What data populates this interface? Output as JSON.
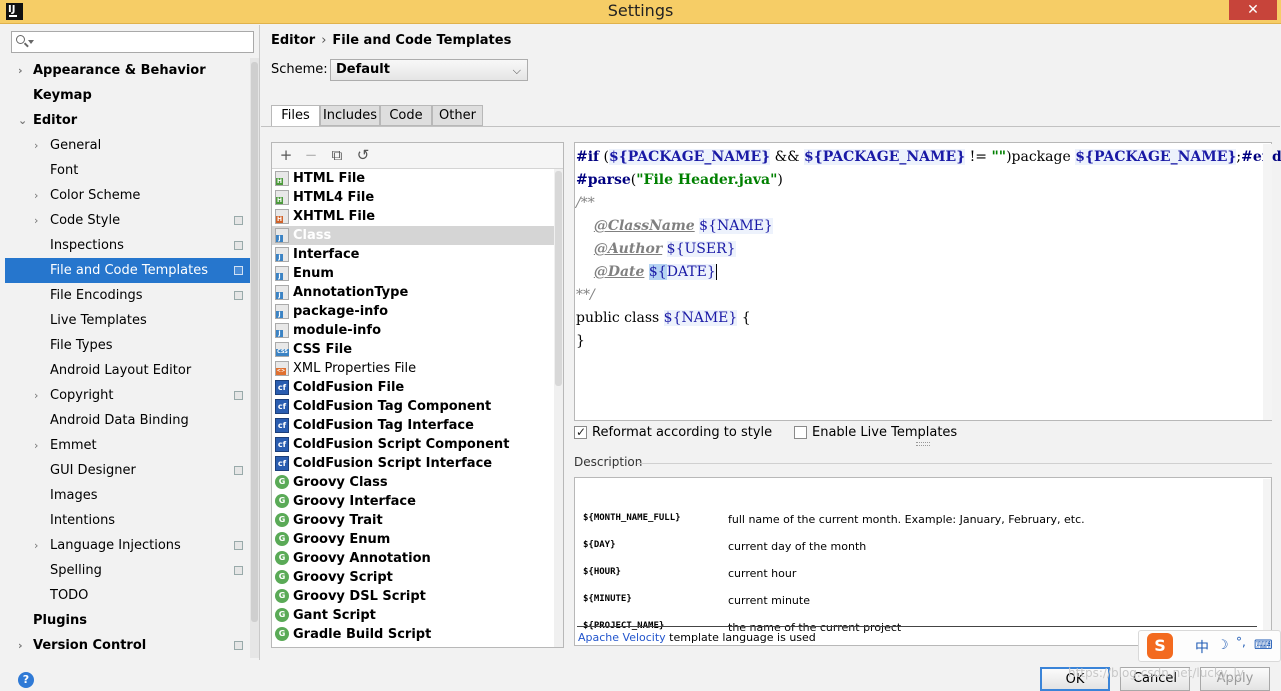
{
  "window": {
    "title": "Settings",
    "app_icon_text": "IJ",
    "close_glyph": "✕"
  },
  "search": {
    "placeholder": "",
    "value": ""
  },
  "sidebar": {
    "items": [
      {
        "label": "Appearance & Behavior",
        "level": 0,
        "bold": true,
        "arrow": "›"
      },
      {
        "label": "Keymap",
        "level": 0,
        "bold": true,
        "arrow": ""
      },
      {
        "label": "Editor",
        "level": 0,
        "bold": true,
        "arrow": "⌄"
      },
      {
        "label": "General",
        "level": 1,
        "arrow": "›"
      },
      {
        "label": "Font",
        "level": 1,
        "arrow": ""
      },
      {
        "label": "Color Scheme",
        "level": 1,
        "arrow": "›"
      },
      {
        "label": "Code Style",
        "level": 1,
        "arrow": "›",
        "project": true
      },
      {
        "label": "Inspections",
        "level": 1,
        "arrow": "",
        "project": true
      },
      {
        "label": "File and Code Templates",
        "level": 1,
        "arrow": "",
        "project": true,
        "selected": true
      },
      {
        "label": "File Encodings",
        "level": 1,
        "arrow": "",
        "project": true
      },
      {
        "label": "Live Templates",
        "level": 1,
        "arrow": ""
      },
      {
        "label": "File Types",
        "level": 1,
        "arrow": ""
      },
      {
        "label": "Android Layout Editor",
        "level": 1,
        "arrow": ""
      },
      {
        "label": "Copyright",
        "level": 1,
        "arrow": "›",
        "project": true
      },
      {
        "label": "Android Data Binding",
        "level": 1,
        "arrow": ""
      },
      {
        "label": "Emmet",
        "level": 1,
        "arrow": "›"
      },
      {
        "label": "GUI Designer",
        "level": 1,
        "arrow": "",
        "project": true
      },
      {
        "label": "Images",
        "level": 1,
        "arrow": ""
      },
      {
        "label": "Intentions",
        "level": 1,
        "arrow": ""
      },
      {
        "label": "Language Injections",
        "level": 1,
        "arrow": "›",
        "project": true
      },
      {
        "label": "Spelling",
        "level": 1,
        "arrow": "",
        "project": true
      },
      {
        "label": "TODO",
        "level": 1,
        "arrow": ""
      },
      {
        "label": "Plugins",
        "level": 0,
        "bold": true,
        "arrow": ""
      },
      {
        "label": "Version Control",
        "level": 0,
        "bold": true,
        "arrow": "›",
        "project": true
      }
    ]
  },
  "breadcrumb": {
    "parent": "Editor",
    "separator": "›",
    "current": "File and Code Templates"
  },
  "scheme": {
    "label": "Scheme:",
    "value": "Default",
    "chevron": "⌵"
  },
  "tabs": [
    {
      "label": "Files",
      "active": true
    },
    {
      "label": "Includes"
    },
    {
      "label": "Code"
    },
    {
      "label": "Other"
    }
  ],
  "toolbar": {
    "add": "+",
    "remove": "−",
    "copy": "⧉",
    "reset": "↺"
  },
  "templates": [
    {
      "label": "HTML File",
      "icon": "html",
      "bold": true
    },
    {
      "label": "HTML4 File",
      "icon": "html",
      "bold": true
    },
    {
      "label": "XHTML File",
      "icon": "xhtml",
      "bold": true
    },
    {
      "label": "Class",
      "icon": "java",
      "bold": true,
      "selected": true
    },
    {
      "label": "Interface",
      "icon": "java",
      "bold": true
    },
    {
      "label": "Enum",
      "icon": "java",
      "bold": true
    },
    {
      "label": "AnnotationType",
      "icon": "java",
      "bold": true
    },
    {
      "label": "package-info",
      "icon": "java",
      "bold": true
    },
    {
      "label": "module-info",
      "icon": "java",
      "bold": true
    },
    {
      "label": "CSS File",
      "icon": "css",
      "bold": true
    },
    {
      "label": "XML Properties File",
      "icon": "xml",
      "bold": false
    },
    {
      "label": "ColdFusion File",
      "icon": "cf",
      "bold": true
    },
    {
      "label": "ColdFusion Tag Component",
      "icon": "cf",
      "bold": true
    },
    {
      "label": "ColdFusion Tag Interface",
      "icon": "cf",
      "bold": true
    },
    {
      "label": "ColdFusion Script Component",
      "icon": "cf",
      "bold": true
    },
    {
      "label": "ColdFusion Script Interface",
      "icon": "cf",
      "bold": true
    },
    {
      "label": "Groovy Class",
      "icon": "groovy",
      "bold": true
    },
    {
      "label": "Groovy Interface",
      "icon": "groovy",
      "bold": true
    },
    {
      "label": "Groovy Trait",
      "icon": "groovy",
      "bold": true
    },
    {
      "label": "Groovy Enum",
      "icon": "groovy",
      "bold": true
    },
    {
      "label": "Groovy Annotation",
      "icon": "groovy",
      "bold": true
    },
    {
      "label": "Groovy Script",
      "icon": "groovy",
      "bold": true
    },
    {
      "label": "Groovy DSL Script",
      "icon": "groovy",
      "bold": true
    },
    {
      "label": "Gant Script",
      "icon": "groovy",
      "bold": true
    },
    {
      "label": "Gradle Build Script",
      "icon": "groovy",
      "bold": true
    }
  ],
  "editor": {
    "line1": {
      "kw_if": "#if",
      "open": " (",
      "var1": "${PACKAGE_NAME}",
      "and": " && ",
      "var2": "${PACKAGE_NAME}",
      "neq": " != ",
      "str": "\"\"",
      "close": ")",
      "pkg": "package ",
      "var3": "${PACKAGE_NAME}",
      "semi": ";",
      "end": "#end"
    },
    "line2": {
      "kw": "#parse",
      "open": "(",
      "str": "\"File Header.java\"",
      "close": ")"
    },
    "line3": "/**",
    "line4": {
      "indent": "    ",
      "tag": "@ClassName",
      "sp": " ",
      "var": "${NAME}"
    },
    "line5": {
      "indent": "    ",
      "tag": "@Author",
      "sp": " ",
      "var": "${USER}"
    },
    "line6": {
      "indent": "    ",
      "tag": "@Date",
      "sp": " ",
      "var_hl": "${",
      "var_rest": "DATE}"
    },
    "line7": "**/",
    "line8": {
      "text": "public class ",
      "var": "${NAME}",
      "rest": " {"
    },
    "line9": "}"
  },
  "options": {
    "reformat": {
      "label": "Reformat according to style",
      "checked": true
    },
    "live_templates": {
      "label": "Enable Live Templates",
      "checked": false
    }
  },
  "description": {
    "label": "Description",
    "rows": [
      {
        "key": "${MONTH_NAME_FULL}",
        "value": "full name of the current month. Example: January, February, etc."
      },
      {
        "key": "${DAY}",
        "value": "current day of the month"
      },
      {
        "key": "${HOUR}",
        "value": "current hour"
      },
      {
        "key": "${MINUTE}",
        "value": "current minute"
      },
      {
        "key": "${PROJECT_NAME}",
        "value": "the name of the current project"
      }
    ],
    "footer_link": "Apache Velocity",
    "footer_text": " template language is used"
  },
  "buttons": {
    "help": "?",
    "ok": "OK",
    "cancel": "Cancel",
    "apply": "Apply"
  },
  "ime": {
    "logo": "S",
    "lang": "中",
    "moon": "☽",
    "punct": "°,",
    "keyboard": "⌨"
  },
  "watermark": "https://blog.csdn.net/lucky_ly"
}
